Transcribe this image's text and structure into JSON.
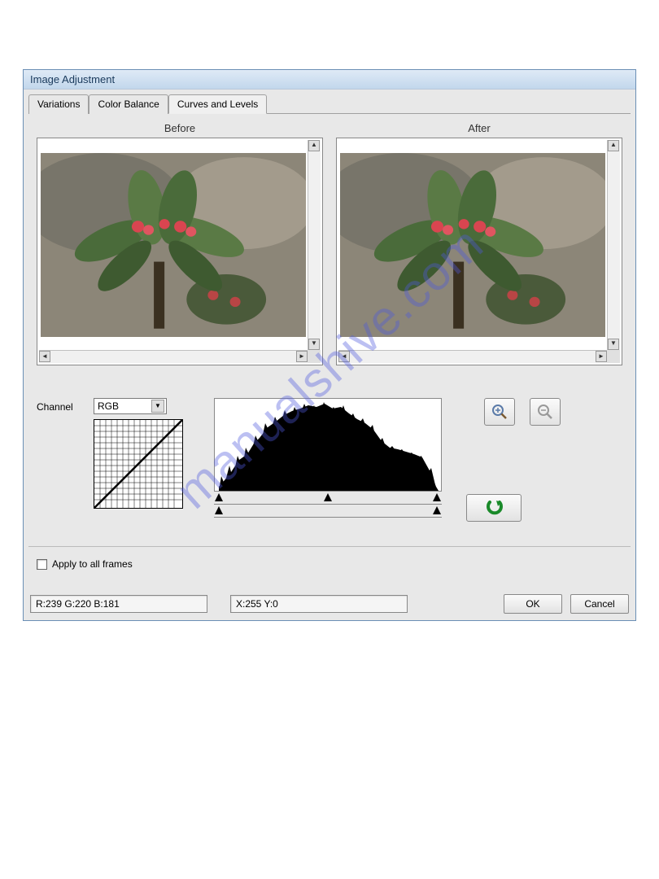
{
  "dialog": {
    "title": "Image Adjustment"
  },
  "tabs": {
    "variations": "Variations",
    "color_balance": "Color Balance",
    "curves_levels": "Curves and Levels"
  },
  "preview": {
    "before_label": "Before",
    "after_label": "After"
  },
  "controls": {
    "channel_label": "Channel",
    "channel_value": "RGB",
    "input_sliders": [
      0,
      50,
      100
    ],
    "output_sliders": [
      0,
      100
    ]
  },
  "footer": {
    "apply_all_label": "Apply to all frames",
    "apply_all_checked": false,
    "rgb_readout": "R:239 G:220 B:181",
    "xy_readout": "X:255 Y:0",
    "ok_label": "OK",
    "cancel_label": "Cancel"
  },
  "watermark": "manualshive.com"
}
